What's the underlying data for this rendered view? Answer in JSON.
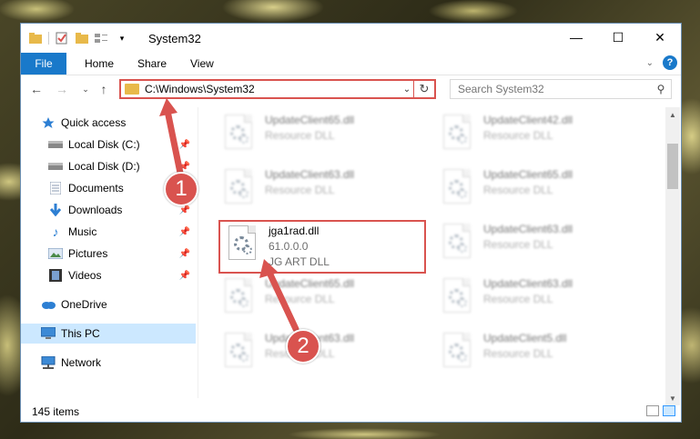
{
  "window": {
    "title": "System32",
    "controls": {
      "minimize": "—",
      "maximize": "☐",
      "close": "✕"
    }
  },
  "ribbon": {
    "tabs": [
      "File",
      "Home",
      "Share",
      "View"
    ],
    "help": "?"
  },
  "nav": {
    "address": "C:\\Windows\\System32",
    "search_placeholder": "Search System32"
  },
  "sidebar": {
    "items": [
      {
        "label": "Quick access",
        "icon": "star-icon"
      },
      {
        "label": "Local Disk (C:)",
        "icon": "drive-icon",
        "pinned": true
      },
      {
        "label": "Local Disk (D:)",
        "icon": "drive-icon",
        "pinned": true
      },
      {
        "label": "Documents",
        "icon": "documents-icon",
        "pinned": true
      },
      {
        "label": "Downloads",
        "icon": "download-icon",
        "pinned": true
      },
      {
        "label": "Music",
        "icon": "music-icon",
        "pinned": true
      },
      {
        "label": "Pictures",
        "icon": "pictures-icon",
        "pinned": true
      },
      {
        "label": "Videos",
        "icon": "videos-icon",
        "pinned": true
      },
      {
        "label": "OneDrive",
        "icon": "cloud-icon"
      },
      {
        "label": "This PC",
        "icon": "computer-icon",
        "selected": true
      },
      {
        "label": "Network",
        "icon": "network-icon"
      }
    ]
  },
  "files": {
    "items": [
      {
        "name": "UpdateClient65.dll",
        "line2": "Resource DLL",
        "line3": ""
      },
      {
        "name": "UpdateClient42.dll",
        "line2": "Resource DLL",
        "line3": ""
      },
      {
        "name": "UpdateClient63.dll",
        "line2": "Resource DLL",
        "line3": ""
      },
      {
        "name": "UpdateClient65.dll",
        "line2": "Resource DLL",
        "line3": ""
      },
      {
        "name": "jga1rad.dll",
        "line2": "61.0.0.0",
        "line3": "JG ART DLL"
      },
      {
        "name": "UpdateClient63.dll",
        "line2": "Resource DLL",
        "line3": ""
      },
      {
        "name": "UpdateClient65.dll",
        "line2": "Resource DLL",
        "line3": ""
      },
      {
        "name": "UpdateClient63.dll",
        "line2": "Resource DLL",
        "line3": ""
      },
      {
        "name": "UpdateClient63.dll",
        "line2": "Resource DLL",
        "line3": ""
      },
      {
        "name": "UpdateClient5.dll",
        "line2": "Resource DLL",
        "line3": ""
      }
    ]
  },
  "status": {
    "count": "145 items"
  },
  "callouts": [
    "1",
    "2"
  ],
  "colors": {
    "accent": "#1979ca",
    "highlight": "#d9534f",
    "selected": "#cce8ff"
  }
}
